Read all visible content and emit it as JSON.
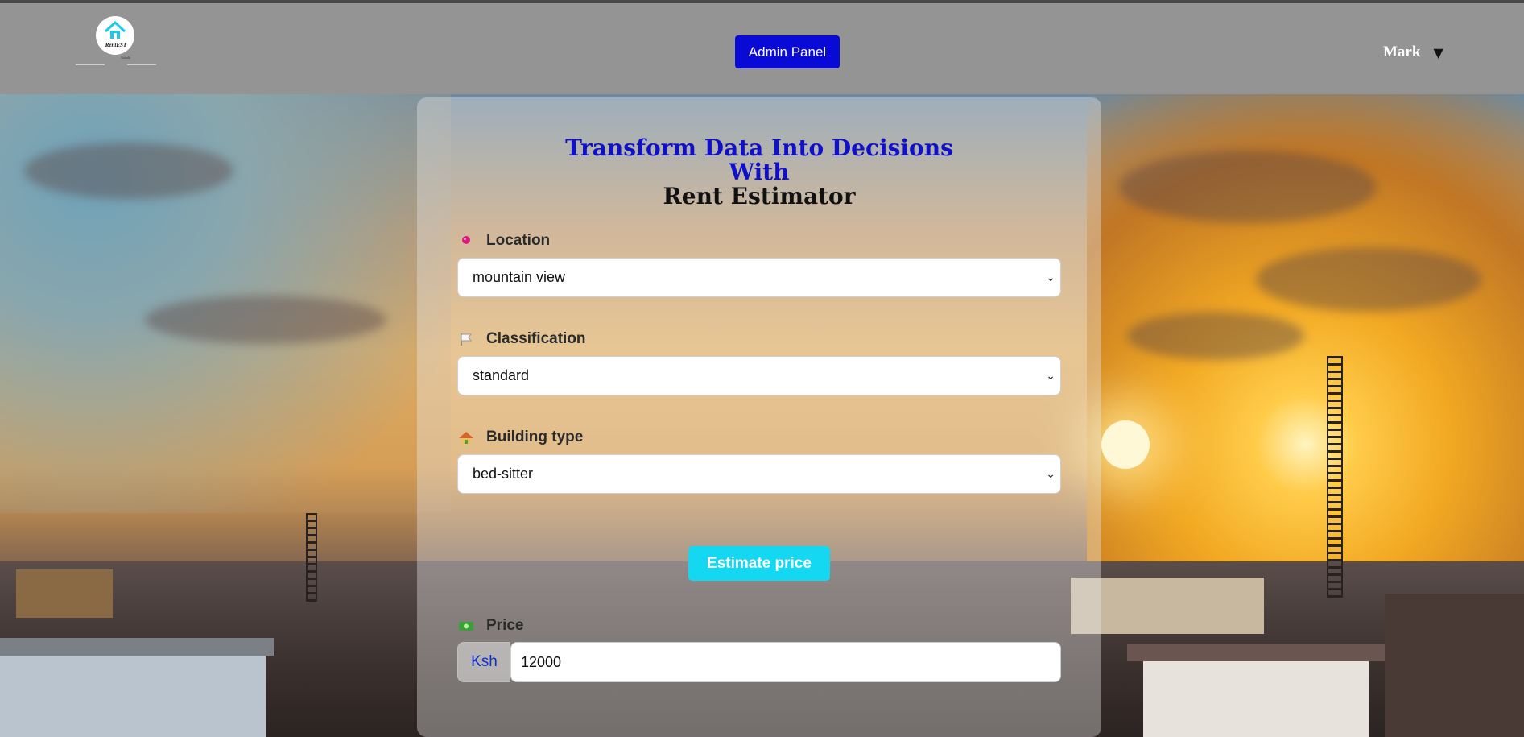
{
  "app": {
    "logo_text": "RentEST",
    "logo_subtext": "Nairobi"
  },
  "navbar": {
    "admin_label": "Admin Panel",
    "user_name": "Mark",
    "user_caret": "▼"
  },
  "headline": {
    "line1": "Transform Data Into Decisions",
    "line2": "With",
    "line3": "Rent Estimator"
  },
  "form": {
    "location": {
      "label": "Location",
      "value": "mountain view",
      "icon": "location-pin-icon"
    },
    "classification": {
      "label": "Classification",
      "value": "standard",
      "icon": "flag-icon"
    },
    "building_type": {
      "label": "Building type",
      "value": "bed-sitter",
      "icon": "house-icon"
    },
    "estimate_label": "Estimate price",
    "price": {
      "label": "Price",
      "currency": "Ksh",
      "value": "12000",
      "icon": "money-icon"
    }
  },
  "colors": {
    "accent_blue": "#0a0ad6",
    "headline_blue": "#1010c8",
    "estimate_button": "#14d8f2",
    "navbar": "#949494"
  }
}
